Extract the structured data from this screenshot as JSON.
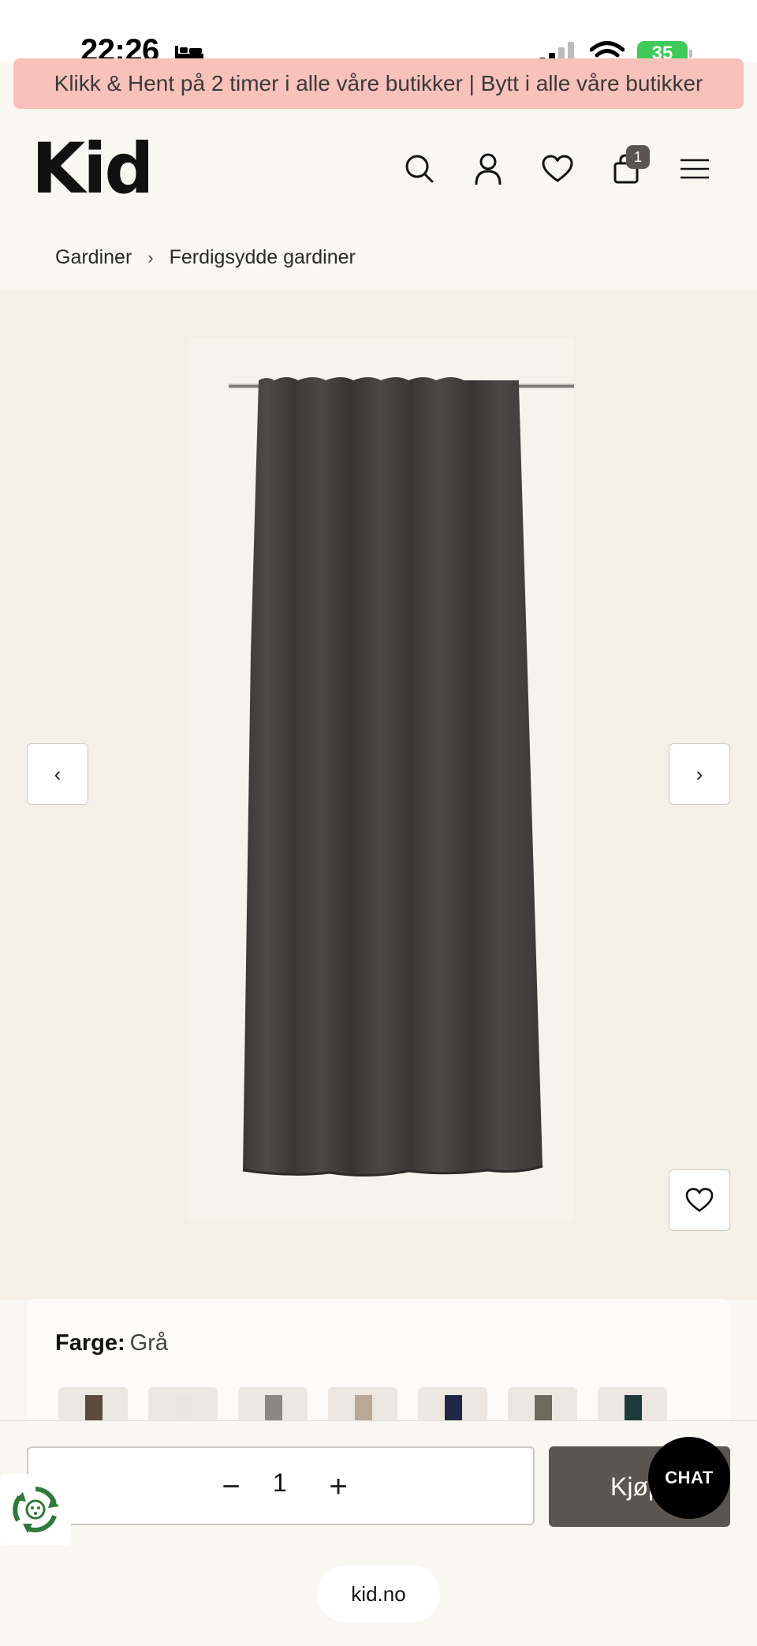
{
  "status_bar": {
    "time": "22:26",
    "battery": "35"
  },
  "promo": {
    "text": "Klikk & Hent på 2 timer i alle våre butikker | Bytt i alle våre butikker"
  },
  "header": {
    "logo": "Kid",
    "cart_count": "1",
    "icons": [
      "search-icon",
      "account-icon",
      "heart-icon",
      "cart-icon",
      "menu-icon"
    ]
  },
  "breadcrumb": {
    "items": [
      "Gardiner",
      "Ferdigsydde gardiner"
    ],
    "separator": "›"
  },
  "gallery": {
    "prev_label": "‹",
    "next_label": "›"
  },
  "product": {
    "color_label": "Farge:",
    "color_value": "Grå",
    "swatches": [
      "#5a4a40",
      "#e8e6e2",
      "#8a8882",
      "#b8a898",
      "#1e2a44",
      "#6b6a5c",
      "#1e3a3a"
    ]
  },
  "buy": {
    "qty": "1",
    "minus": "−",
    "plus": "+",
    "buy_label": "Kjøp",
    "chat_label": "CHAT"
  },
  "browser": {
    "url": "kid.no"
  }
}
